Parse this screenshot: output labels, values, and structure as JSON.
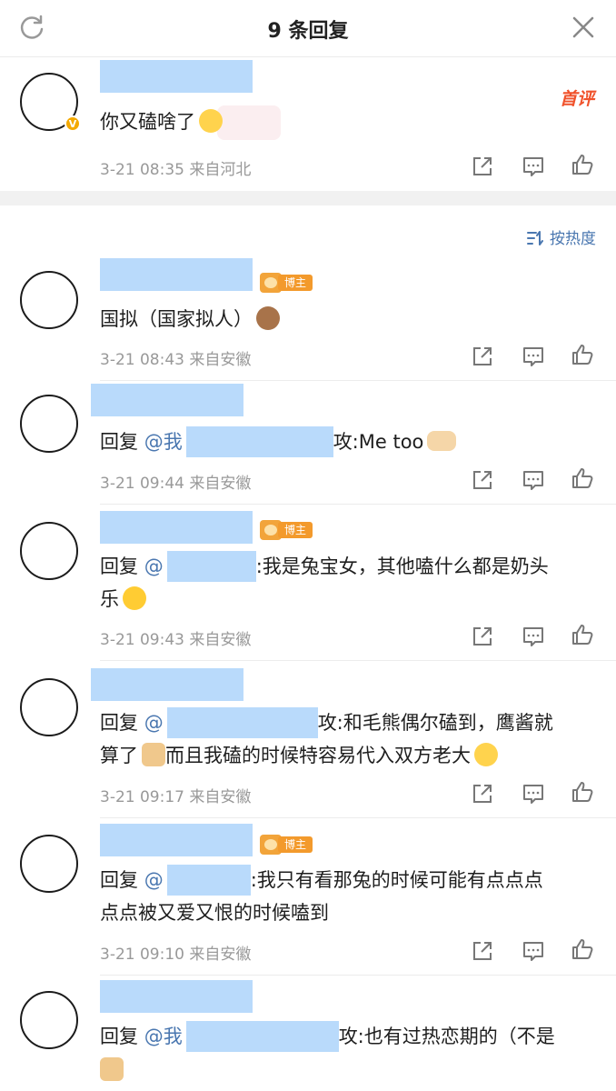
{
  "header": {
    "title": "9 条回复"
  },
  "root": {
    "text": "你又磕啥了",
    "time": "3-21 08:35",
    "location": "来自河北",
    "badge": "首评"
  },
  "sort_label": "按热度",
  "replies": [
    {
      "text": "国拟（国家拟人）",
      "time": "3-21 08:43",
      "location": "来自安徽",
      "tag": "博主"
    },
    {
      "prefix": "回复",
      "at": "@我",
      "after": "攻:Me too",
      "time": "3-21 09:44",
      "location": "来自安徽"
    },
    {
      "prefix": "回复",
      "at": "@",
      "after": ":我是兔宝女，其他嗑什么都是奶头",
      "line2": "乐",
      "time": "3-21 09:43",
      "location": "来自安徽",
      "tag": "博主"
    },
    {
      "prefix": "回复",
      "at": "@",
      "after": "攻:和毛熊偶尔磕到，鹰酱就",
      "line2": "算了",
      "line2b": "而且我磕的时候特容易代入双方老大",
      "time": "3-21 09:17",
      "location": "来自安徽"
    },
    {
      "prefix": "回复",
      "at": "@",
      "after": ":我只有看那兔的时候可能有点点点",
      "line2": "点点被又爱又恨的时候嗑到",
      "time": "3-21 09:10",
      "location": "来自安徽",
      "tag": "博主"
    },
    {
      "prefix": "回复",
      "at": "@我",
      "after": "攻:也有过热恋期的（不是"
    }
  ]
}
